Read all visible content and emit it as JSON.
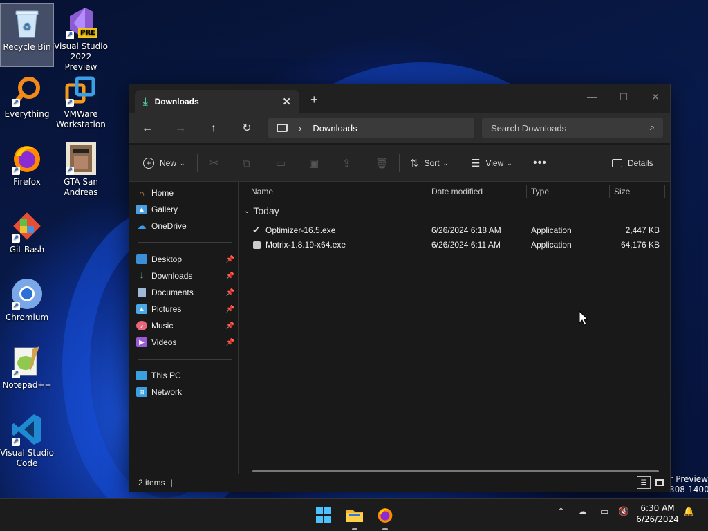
{
  "desktop": {
    "icons": [
      {
        "label": "Recycle Bin",
        "icon": "recycle-bin-icon"
      },
      {
        "label": "Visual Studio 2022 Preview",
        "icon": "visual-studio-preview-icon",
        "badge": "PRE"
      },
      {
        "label": "Everything",
        "icon": "everything-search-icon"
      },
      {
        "label": "VMWare Workstation",
        "icon": "vmware-icon"
      },
      {
        "label": "Firefox",
        "icon": "firefox-icon"
      },
      {
        "label": "GTA San Andreas",
        "icon": "gta-sa-icon"
      },
      {
        "label": "Git Bash",
        "icon": "git-bash-icon"
      },
      {
        "label": "Chromium",
        "icon": "chromium-icon"
      },
      {
        "label": "Notepad++",
        "icon": "notepadpp-icon"
      },
      {
        "label": "Visual Studio Code",
        "icon": "vscode-icon"
      }
    ],
    "watermark": {
      "line1": "r Preview",
      "line2": "308-1400"
    }
  },
  "explorer": {
    "tab_title": "Downloads",
    "address_segment": "Downloads",
    "search_placeholder": "Search Downloads",
    "toolbar": {
      "new": "New",
      "sort": "Sort",
      "view": "View",
      "details": "Details"
    },
    "sidebar": {
      "top": [
        {
          "label": "Home"
        },
        {
          "label": "Gallery"
        },
        {
          "label": "OneDrive"
        }
      ],
      "pinned": [
        {
          "label": "Desktop"
        },
        {
          "label": "Downloads"
        },
        {
          "label": "Documents"
        },
        {
          "label": "Pictures"
        },
        {
          "label": "Music"
        },
        {
          "label": "Videos"
        }
      ],
      "bottom": [
        {
          "label": "This PC"
        },
        {
          "label": "Network"
        }
      ]
    },
    "columns": {
      "name": "Name",
      "date": "Date modified",
      "type": "Type",
      "size": "Size"
    },
    "group": "Today",
    "files": [
      {
        "name": "Optimizer-16.5.exe",
        "date": "6/26/2024 6:18 AM",
        "type": "Application",
        "size": "2,447 KB"
      },
      {
        "name": "Motrix-1.8.19-x64.exe",
        "date": "6/26/2024 6:11 AM",
        "type": "Application",
        "size": "64,176 KB"
      }
    ],
    "status": "2 items"
  },
  "taskbar": {
    "time": "6:30 AM",
    "date": "6/26/2024"
  }
}
